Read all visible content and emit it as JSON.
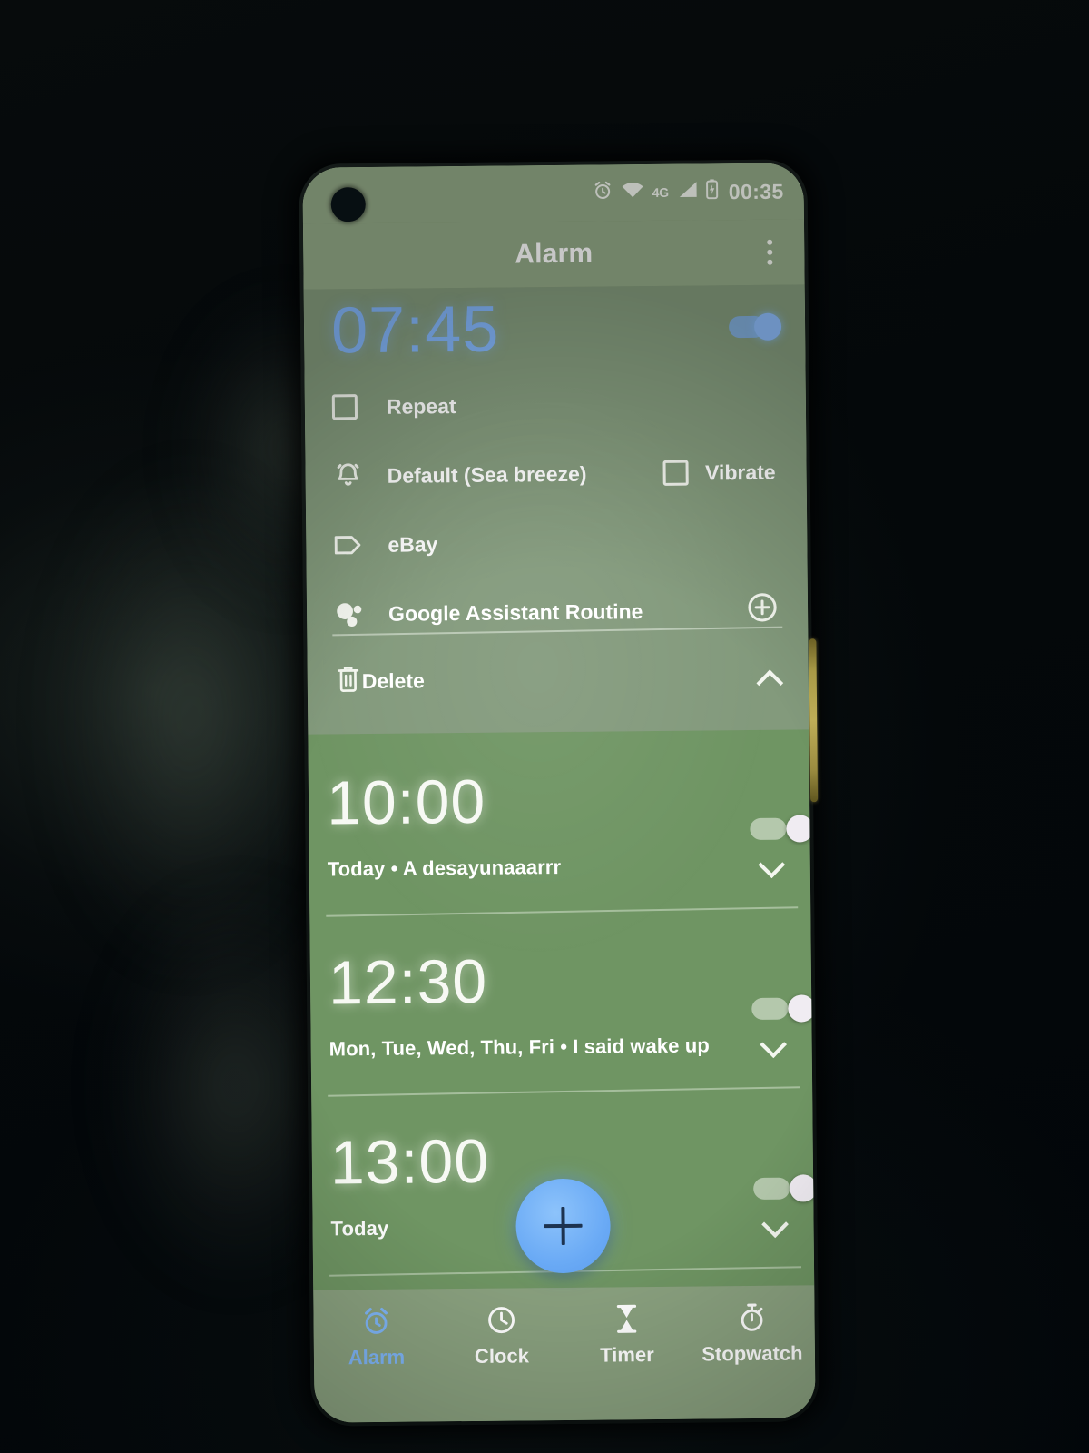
{
  "status_bar": {
    "clock": "00:35",
    "network": "4G",
    "icons": [
      "alarm-set-icon",
      "wifi-icon",
      "signal-icon",
      "battery-icon"
    ]
  },
  "app_bar": {
    "title": "Alarm",
    "overflow_label": "More options"
  },
  "expanded_alarm": {
    "time": "07:45",
    "enabled": true,
    "repeat_label": "Repeat",
    "repeat_checked": false,
    "ringtone_label": "Default (Sea breeze)",
    "vibrate_label": "Vibrate",
    "vibrate_checked": false,
    "tag_label": "eBay",
    "assistant_label": "Google Assistant Routine",
    "delete_label": "Delete"
  },
  "alarms": [
    {
      "time": "10:00",
      "enabled": false,
      "subtitle": "Today  •  A desayunaaarrr"
    },
    {
      "time": "12:30",
      "enabled": false,
      "subtitle": "Mon, Tue, Wed, Thu, Fri  •  I said wake up"
    },
    {
      "time": "13:00",
      "enabled": false,
      "subtitle": "Today"
    }
  ],
  "fab": {
    "label": "+"
  },
  "bottom_nav": {
    "items": [
      {
        "label": "Alarm",
        "icon": "alarm-clock-icon",
        "active": true
      },
      {
        "label": "Clock",
        "icon": "clock-icon",
        "active": false
      },
      {
        "label": "Timer",
        "icon": "hourglass-icon",
        "active": false
      },
      {
        "label": "Stopwatch",
        "icon": "stopwatch-icon",
        "active": false
      }
    ]
  },
  "colors": {
    "accent_blue": "#7fb6f8",
    "screen_green": "#6f9563",
    "card_green": "#839a7c",
    "bar_green": "#93a987"
  }
}
